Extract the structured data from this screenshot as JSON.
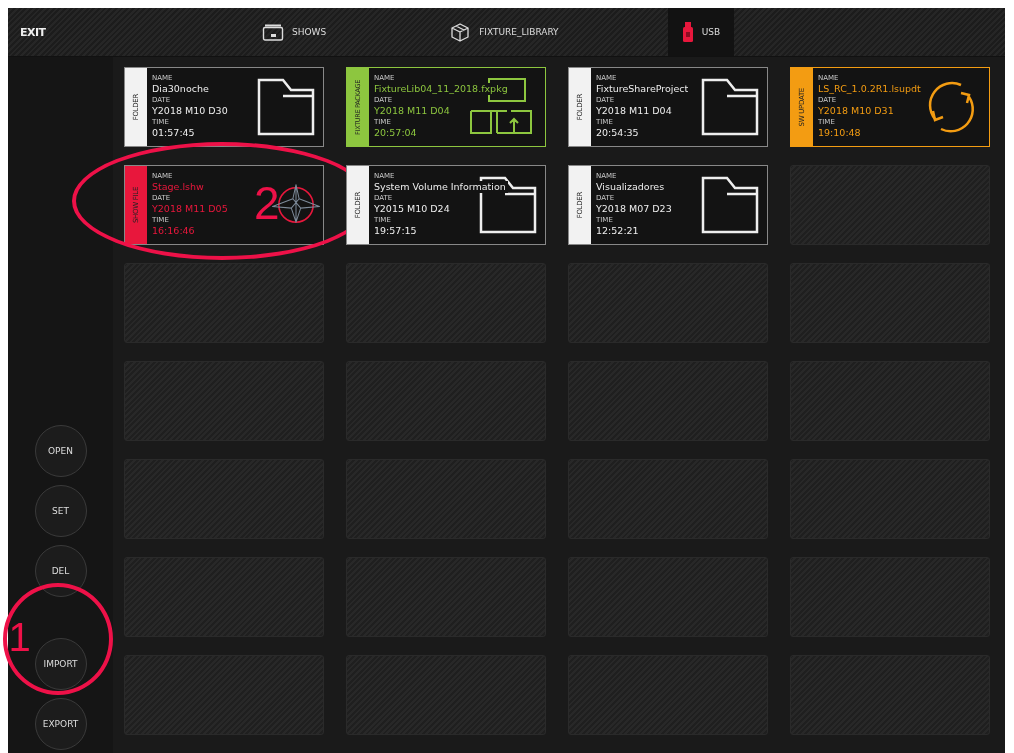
{
  "topbar": {
    "exit": "EXIT",
    "tabs": [
      {
        "kind": "shows",
        "label": "SHOWS",
        "selected": false
      },
      {
        "kind": "library",
        "label": "FIXTURE_LIBRARY",
        "selected": false
      },
      {
        "kind": "usb",
        "label": "USB",
        "selected": true
      }
    ]
  },
  "sidebar": {
    "button_groups": [
      [
        {
          "label": "OPEN"
        },
        {
          "label": "SET"
        },
        {
          "label": "DEL"
        }
      ],
      [
        {
          "label": "IMPORT",
          "callout": "1"
        },
        {
          "label": "EXPORT"
        }
      ]
    ]
  },
  "files": [
    {
      "kind": "folder",
      "type_label": "FOLDER",
      "fields": [
        {
          "label": "NAME",
          "value": "Dia30noche"
        },
        {
          "label": "DATE",
          "value": "Y2018 M10 D30"
        },
        {
          "label": "TIME",
          "value": "01:57:45"
        }
      ]
    },
    {
      "kind": "fixture_package",
      "type_label": "FIXTURE PACKAGE",
      "fields": [
        {
          "label": "NAME",
          "value": "FixtureLib04_11_2018.fxpkg"
        },
        {
          "label": "DATE",
          "value": "Y2018 M11 D04"
        },
        {
          "label": "TIME",
          "value": "20:57:04"
        }
      ]
    },
    {
      "kind": "folder",
      "type_label": "FOLDER",
      "fields": [
        {
          "label": "NAME",
          "value": "FixtureShareProject"
        },
        {
          "label": "DATE",
          "value": "Y2018 M11 D04"
        },
        {
          "label": "TIME",
          "value": "20:54:35"
        }
      ]
    },
    {
      "kind": "sw_update",
      "type_label": "SW UPDATE",
      "fields": [
        {
          "label": "NAME",
          "value": "LS_RC_1.0.2R1.lsupdt"
        },
        {
          "label": "DATE",
          "value": "Y2018 M10 D31"
        },
        {
          "label": "TIME",
          "value": "19:10:48"
        }
      ]
    },
    {
      "kind": "show_file",
      "type_label": "SHOW FILE",
      "callout": "2",
      "fields": [
        {
          "label": "NAME",
          "value": "Stage.lshw"
        },
        {
          "label": "DATE",
          "value": "Y2018 M11 D05"
        },
        {
          "label": "TIME",
          "value": "16:16:46"
        }
      ]
    },
    {
      "kind": "folder",
      "type_label": "FOLDER",
      "fields": [
        {
          "label": "NAME",
          "value": "System Volume Information"
        },
        {
          "label": "DATE",
          "value": "Y2015 M10 D24"
        },
        {
          "label": "TIME",
          "value": "19:57:15"
        }
      ]
    },
    {
      "kind": "folder",
      "type_label": "FOLDER",
      "fields": [
        {
          "label": "NAME",
          "value": "Visualizadores"
        },
        {
          "label": "DATE",
          "value": "Y2018 M07 D23"
        },
        {
          "label": "TIME",
          "value": "12:52:21"
        }
      ]
    },
    {
      "kind": "empty"
    },
    {
      "kind": "empty"
    },
    {
      "kind": "empty"
    },
    {
      "kind": "empty"
    },
    {
      "kind": "empty"
    },
    {
      "kind": "empty"
    },
    {
      "kind": "empty"
    },
    {
      "kind": "empty"
    },
    {
      "kind": "empty"
    },
    {
      "kind": "empty"
    },
    {
      "kind": "empty"
    },
    {
      "kind": "empty"
    },
    {
      "kind": "empty"
    },
    {
      "kind": "empty"
    },
    {
      "kind": "empty"
    },
    {
      "kind": "empty"
    },
    {
      "kind": "empty"
    },
    {
      "kind": "empty"
    },
    {
      "kind": "empty"
    },
    {
      "kind": "empty"
    },
    {
      "kind": "empty"
    }
  ]
}
